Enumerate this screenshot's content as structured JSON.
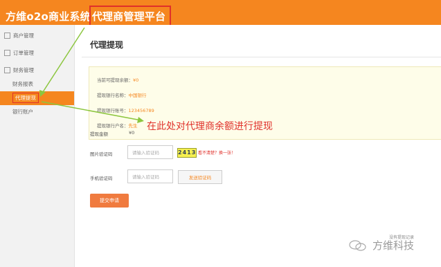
{
  "header": {
    "brand_prefix": "方维o2o商业系统",
    "brand_highlight": "代理商管理平台"
  },
  "sidebar": {
    "items": [
      {
        "label": "商户管理"
      },
      {
        "label": "订单管理"
      },
      {
        "label": "财务管理"
      }
    ],
    "subitems": [
      {
        "label": "财务报表"
      },
      {
        "label": "代理提现"
      },
      {
        "label": "银行账户"
      }
    ]
  },
  "main": {
    "title": "代理提现",
    "info": {
      "balance_label": "当前可提现余额：",
      "balance_value": "¥0",
      "bank_name_label": "提现银行名称：",
      "bank_name_value": "中国银行",
      "account_label": "提现银行账号：",
      "account_value": "123456789",
      "holder_label": "提现银行户名：",
      "holder_value": "先生"
    },
    "form": {
      "amount_label": "提现金额",
      "amount_value": "¥0",
      "captcha_label": "图片验证码",
      "captcha_placeholder": "请输入验证码",
      "captcha_image_text": "2413",
      "captcha_refresh": "看不清楚？换一张！",
      "sms_label": "手机验证码",
      "sms_placeholder": "请输入验证码",
      "send_code": "发送验证码",
      "submit": "提交申请"
    },
    "footer_link": "没有提现记录"
  },
  "annotation": "在此处对代理商余额进行提现",
  "watermark": "方维科技",
  "colors": {
    "accent": "#f5861f",
    "highlight_red": "#e0302a",
    "info_bg": "#fefde9",
    "annotation_green": "#8cc63f"
  }
}
